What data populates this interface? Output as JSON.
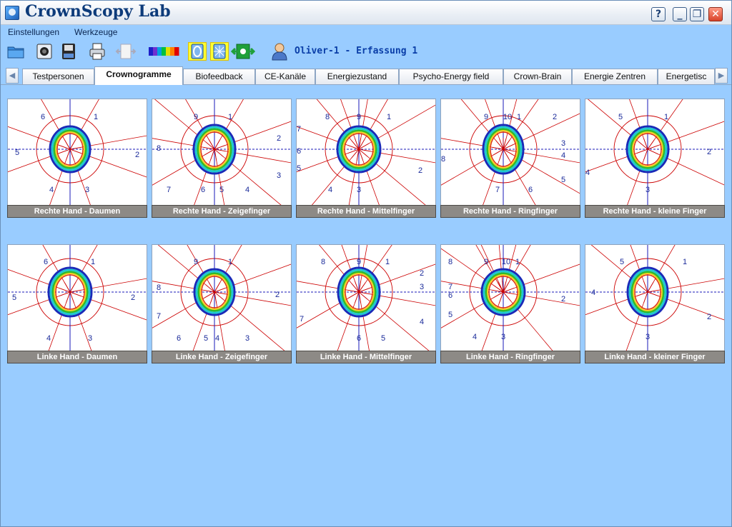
{
  "window": {
    "title": "CrownScopy Lab"
  },
  "title_buttons": {
    "help": "?",
    "minimize": "_",
    "maximize": "❐",
    "close": "✕"
  },
  "menu": [
    "Einstellungen",
    "Werkzeuge"
  ],
  "toolbar": {
    "recording_label": "Oliver-1 - Erfassung 1",
    "buttons": [
      "open-folder-icon",
      "camera-icon",
      "save-icon",
      "print-icon",
      "zoom-out-icon",
      "color-palette-icon",
      "bright-mode-icon",
      "contrast-mode-icon",
      "adjust-icon",
      "person-icon"
    ],
    "palette_colors": [
      "#1e1ec8",
      "#7030d0",
      "#00a0e0",
      "#00c040",
      "#e0e000",
      "#ff8000",
      "#e00000"
    ]
  },
  "tabs": [
    {
      "label": "Testpersonen",
      "active": false
    },
    {
      "label": "Crownogramme",
      "active": true
    },
    {
      "label": "Biofeedback",
      "active": false
    },
    {
      "label": "CE-Kanäle",
      "active": false
    },
    {
      "label": "Energiezustand",
      "active": false
    },
    {
      "label": "Psycho-Energy field",
      "active": false
    },
    {
      "label": "Crown-Brain",
      "active": false
    },
    {
      "label": "Energie Zentren",
      "active": false
    },
    {
      "label": "Energetisc",
      "active": false
    }
  ],
  "colors": {
    "sector_line": "#cc0000",
    "axis": "#1a1ab8",
    "label": "#1a2a9a",
    "caption_bg": "#8d8a86"
  },
  "crownograms": [
    {
      "caption": "Rechte Hand - Daumen",
      "labels": [
        "6",
        "1",
        "5",
        "2",
        "4",
        "3"
      ]
    },
    {
      "caption": "Rechte Hand - Zeigefinger",
      "labels": [
        "9",
        "1",
        "2",
        "8",
        "3",
        "7",
        "6",
        "5",
        "4"
      ]
    },
    {
      "caption": "Rechte Hand - Mittelfinger",
      "labels": [
        "8",
        "9",
        "1",
        "7",
        "6",
        "5",
        "2",
        "4",
        "3"
      ]
    },
    {
      "caption": "Rechte Hand - Ringfinger",
      "labels": [
        "9",
        "10",
        "1",
        "2",
        "3",
        "4",
        "8",
        "5",
        "7",
        "6"
      ]
    },
    {
      "caption": "Rechte Hand - kleine Finger",
      "labels": [
        "5",
        "1",
        "2",
        "4",
        "3"
      ]
    },
    {
      "caption": "Linke Hand - Daumen",
      "labels": [
        "6",
        "1",
        "5",
        "2",
        "4",
        "3"
      ]
    },
    {
      "caption": "Linke Hand - Zeigefinger",
      "labels": [
        "9",
        "1",
        "8",
        "2",
        "7",
        "6",
        "5",
        "4",
        "3"
      ]
    },
    {
      "caption": "Linke Hand - Mittelfinger",
      "labels": [
        "8",
        "9",
        "1",
        "2",
        "3",
        "7",
        "4",
        "6",
        "5"
      ]
    },
    {
      "caption": "Linke Hand - Ringfinger",
      "labels": [
        "8",
        "9",
        "10",
        "1",
        "7",
        "6",
        "2",
        "5",
        "4",
        "3"
      ]
    },
    {
      "caption": "Linke Hand - kleiner Finger",
      "labels": [
        "5",
        "1",
        "4",
        "2",
        "3"
      ]
    }
  ]
}
